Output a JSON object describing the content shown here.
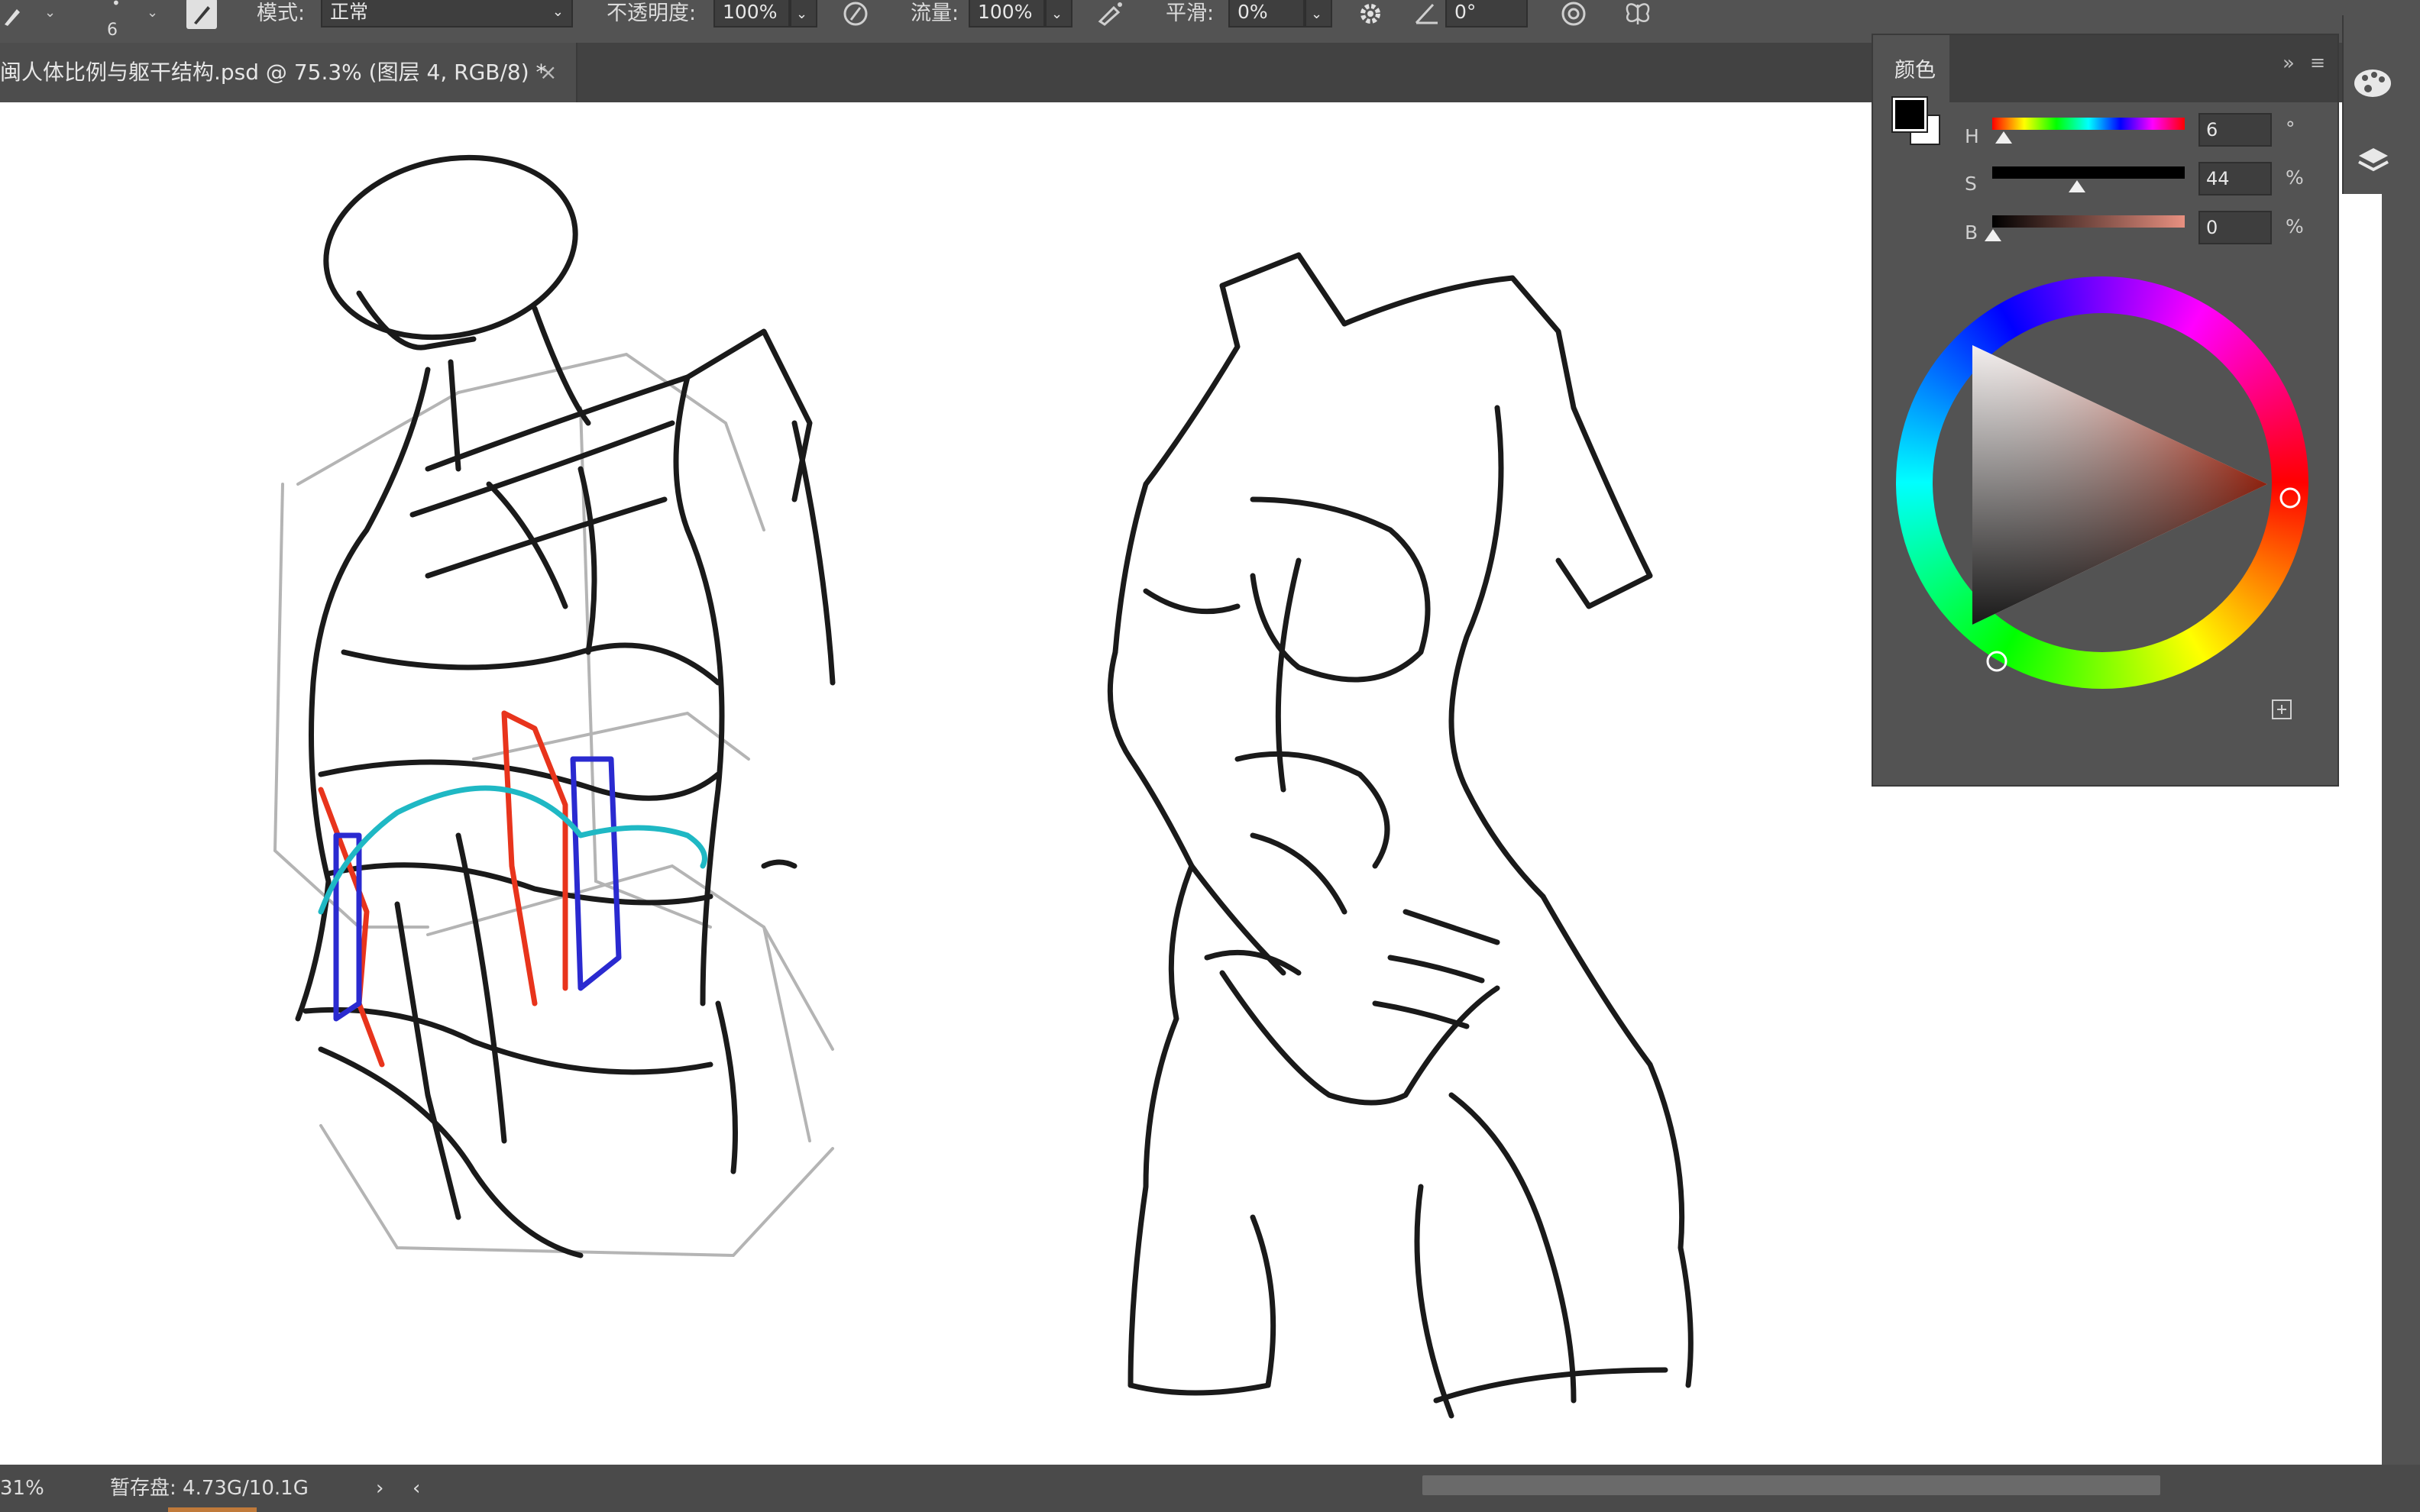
{
  "options_bar": {
    "brush_size": "6",
    "mode_label": "模式:",
    "mode_value": "正常",
    "opacity_label": "不透明度:",
    "opacity_value": "100%",
    "flow_label": "流量:",
    "flow_value": "100%",
    "smoothing_label": "平滑:",
    "smoothing_value": "0%",
    "angle_value": "0°"
  },
  "document_tab": {
    "title": "闽人体比例与躯干结构.psd @ 75.3% (图层 4, RGB/8) *",
    "close": "×"
  },
  "color_panel": {
    "tab_label": "颜色",
    "foreground_color": "#000000",
    "background_color": "#ffffff",
    "sliders": [
      {
        "label": "H",
        "value": "6",
        "unit": "°",
        "thumb_fraction": 0.02
      },
      {
        "label": "S",
        "value": "44",
        "unit": "%",
        "thumb_fraction": 0.44
      },
      {
        "label": "B",
        "value": "0",
        "unit": "%",
        "thumb_fraction": 0.0
      }
    ],
    "wheel_hue_degrees": 6
  },
  "status_bar": {
    "zoom": "31%",
    "scratch_disk": "暂存盘: 4.73G/10.1G",
    "arrow_right": "›",
    "arrow_left": "‹"
  },
  "accent_colors": {
    "cyan_stroke": "#1fb8c4",
    "red_stroke": "#e8341c",
    "blue_stroke": "#2a2ad0"
  },
  "icons": [
    "brush-icon",
    "brush-preset-icon",
    "pressure-opacity-icon",
    "airbrush-icon",
    "settings-gear-icon",
    "angle-icon",
    "pressure-size-icon",
    "symmetry-butterfly-icon",
    "palette-icon",
    "layers-icon",
    "new-swatch-icon",
    "panel-collapse-icon",
    "panel-menu-icon"
  ]
}
